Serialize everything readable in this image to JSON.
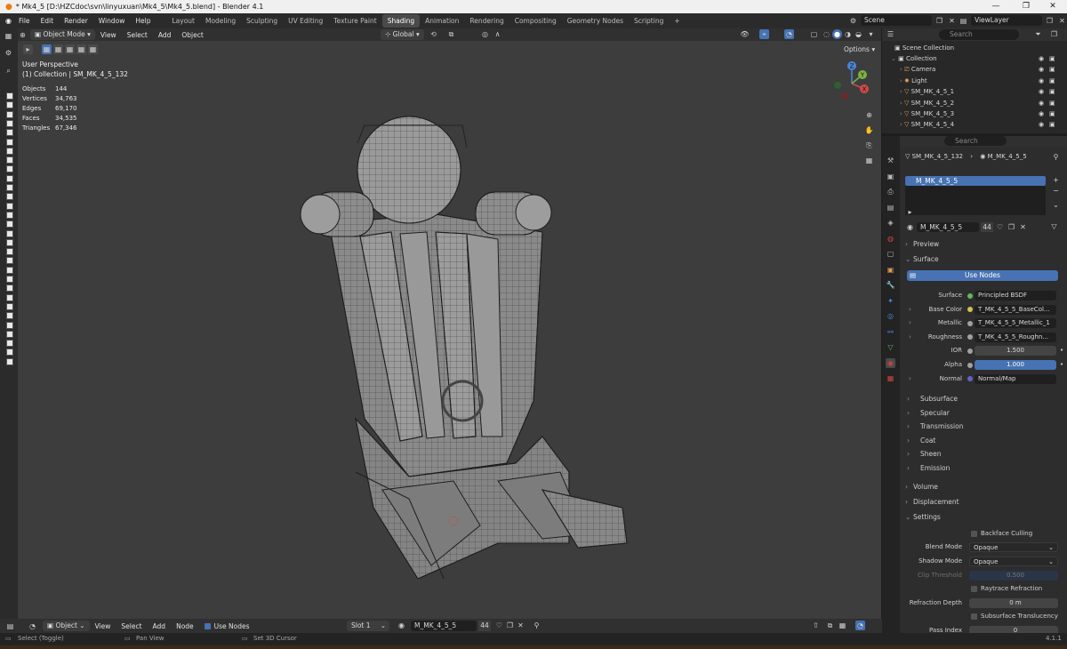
{
  "window": {
    "title": "* Mk4_5 [D:\\HZCdoc\\svn\\linyuxuan\\Mk4_5\\Mk4_5.blend] - Blender 4.1",
    "minimize": "—",
    "maximize": "❐",
    "close": "✕"
  },
  "menus": [
    "File",
    "Edit",
    "Render",
    "Window",
    "Help"
  ],
  "workspaces": [
    {
      "label": "Layout",
      "active": false
    },
    {
      "label": "Modeling",
      "active": false
    },
    {
      "label": "Sculpting",
      "active": false
    },
    {
      "label": "UV Editing",
      "active": false
    },
    {
      "label": "Texture Paint",
      "active": false
    },
    {
      "label": "Shading",
      "active": true
    },
    {
      "label": "Animation",
      "active": false
    },
    {
      "label": "Rendering",
      "active": false
    },
    {
      "label": "Compositing",
      "active": false
    },
    {
      "label": "Geometry Nodes",
      "active": false
    },
    {
      "label": "Scripting",
      "active": false
    }
  ],
  "add_workspace": "+",
  "scene": {
    "label": "Scene",
    "view_layer": "ViewLayer"
  },
  "viewport_header": {
    "mode": "Object Mode",
    "view": "View",
    "select": "Select",
    "add": "Add",
    "object": "Object",
    "transform_orientation": "Global",
    "options": "Options"
  },
  "viewport_overlay": {
    "perspective": "User Perspective",
    "collection": "(1) Collection | SM_MK_4_5_132",
    "stats": [
      {
        "label": "Objects",
        "value": "144"
      },
      {
        "label": "Vertices",
        "value": "34,763"
      },
      {
        "label": "Edges",
        "value": "69,170"
      },
      {
        "label": "Faces",
        "value": "34,535"
      },
      {
        "label": "Triangles",
        "value": "67,346"
      }
    ]
  },
  "gizmo": {
    "x": "X",
    "y": "Y",
    "z": "Z"
  },
  "outliner": {
    "search_placeholder": "Search",
    "scene_collection": "Scene Collection",
    "items": [
      {
        "label": "Collection",
        "indent": 1,
        "icon": "collection-icon",
        "color": "#d8d8d8"
      },
      {
        "label": "Camera",
        "indent": 2,
        "icon": "camera-icon",
        "color": "#e09a53"
      },
      {
        "label": "Light",
        "indent": 2,
        "icon": "light-icon",
        "color": "#e09a53"
      },
      {
        "label": "SM_MK_4_5_1",
        "indent": 2,
        "icon": "mesh-icon",
        "color": "#e09a53"
      },
      {
        "label": "SM_MK_4_5_2",
        "indent": 2,
        "icon": "mesh-icon",
        "color": "#e09a53"
      },
      {
        "label": "SM_MK_4_5_3",
        "indent": 2,
        "icon": "mesh-icon",
        "color": "#e09a53"
      },
      {
        "label": "SM_MK_4_5_4",
        "indent": 2,
        "icon": "mesh-icon",
        "color": "#e09a53"
      }
    ]
  },
  "properties": {
    "search_placeholder": "Search",
    "breadcrumb_object": "SM_MK_4_5_132",
    "breadcrumb_material": "M_MK_4_5_5",
    "slot_name": "M_MK_4_5_5",
    "material_name": "M_MK_4_5_5",
    "user_count": "44",
    "sections": {
      "preview": "Preview",
      "surface": "Surface",
      "use_nodes": "Use Nodes",
      "subsurface": "Subsurface",
      "specular": "Specular",
      "transmission": "Transmission",
      "coat": "Coat",
      "sheen": "Sheen",
      "emission": "Emission",
      "volume": "Volume",
      "displacement": "Displacement",
      "settings": "Settings"
    },
    "surface_fields": [
      {
        "label": "Surface",
        "value": "Principled BSDF",
        "dot": "#5fb85f",
        "expand": false
      },
      {
        "label": "Base Color",
        "value": "T_MK_4_5_5_BaseCol...",
        "dot": "#d1c44b",
        "expand": true
      },
      {
        "label": "Metallic",
        "value": "T_MK_4_5_5_Metallic_1",
        "dot": "#a1a1a1",
        "expand": true
      },
      {
        "label": "Roughness",
        "value": "T_MK_4_5_5_Roughn...",
        "dot": "#a1a1a1",
        "expand": true
      },
      {
        "label": "IOR",
        "value": "1.500",
        "dot": "#a1a1a1",
        "expand": false
      },
      {
        "label": "Alpha",
        "value": "1.000",
        "dot": "#a1a1a1",
        "expand": false,
        "blue": true
      },
      {
        "label": "Normal",
        "value": "Normal/Map",
        "dot": "#6363c7",
        "expand": true
      }
    ],
    "settings": {
      "backface_culling": "Backface Culling",
      "blend_mode_label": "Blend Mode",
      "blend_mode": "Opaque",
      "shadow_mode_label": "Shadow Mode",
      "shadow_mode": "Opaque",
      "clip_threshold_label": "Clip Threshold",
      "clip_threshold": "0.500",
      "raytrace_refraction": "Raytrace Refraction",
      "refraction_depth_label": "Refraction Depth",
      "refraction_depth": "0 m",
      "subsurface_translucency": "Subsurface Translucency",
      "pass_index_label": "Pass Index",
      "pass_index": "0"
    }
  },
  "node_editor_header": {
    "object": "Object",
    "view": "View",
    "select": "Select",
    "add": "Add",
    "node": "Node",
    "use_nodes": "Use Nodes",
    "slot": "Slot 1",
    "material": "M_MK_4_5_5",
    "user_count": "44"
  },
  "statusbar": {
    "select": "Select (Toggle)",
    "pan": "Pan View",
    "cursor": "Set 3D Cursor",
    "version": "4.1.1"
  }
}
